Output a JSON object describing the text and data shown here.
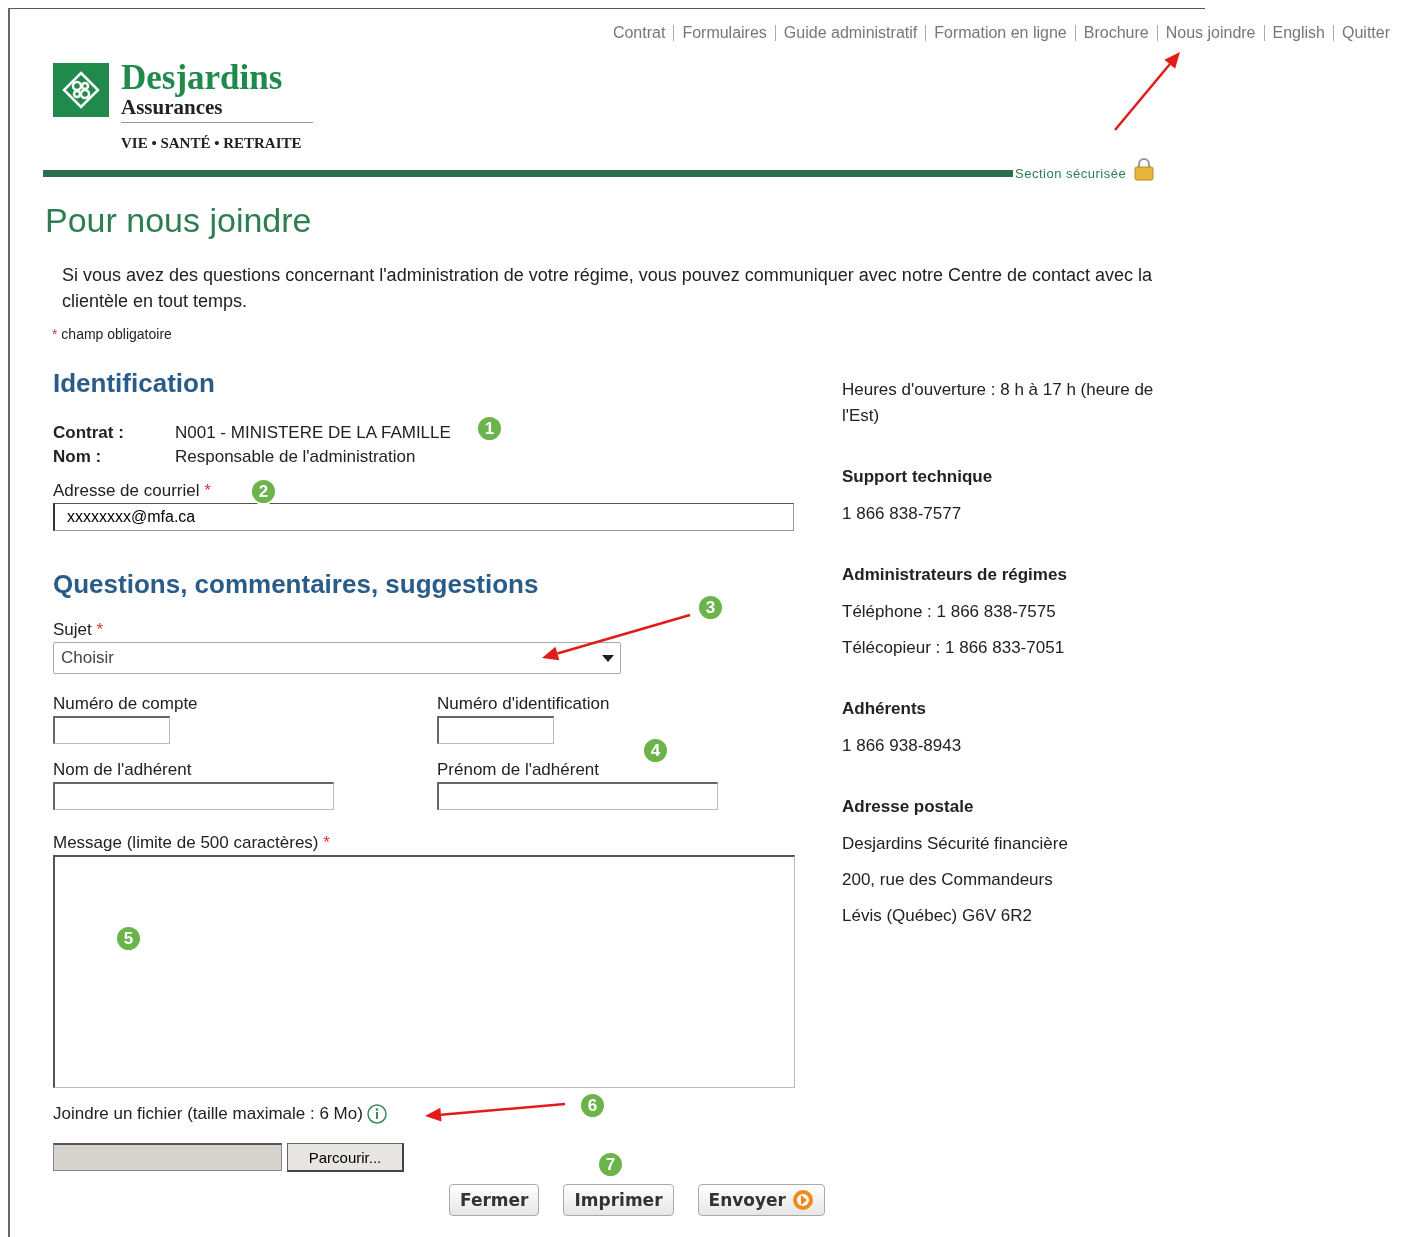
{
  "nav": [
    {
      "label": "Contrat"
    },
    {
      "label": "Formulaires"
    },
    {
      "label": "Guide administratif"
    },
    {
      "label": "Formation en ligne"
    },
    {
      "label": "Brochure"
    },
    {
      "label": "Nous joindre"
    },
    {
      "label": "English"
    },
    {
      "label": "Quitter"
    }
  ],
  "logo": {
    "name": "Desjardins",
    "division": "Assurances",
    "tagline": "VIE • SANTÉ • RETRAITE"
  },
  "secure_label": "Section sécurisée",
  "title": "Pour nous joindre",
  "intro": "Si vous avez des questions concernant l'administration de votre régime, vous pouvez communiquer avec notre Centre de contact avec la clientèle en tout temps.",
  "required_note": {
    "mark": "*",
    "text": "champ obligatoire"
  },
  "identification": {
    "heading": "Identification",
    "info": [
      {
        "label": "Contrat :",
        "value": "N001 - MINISTERE DE LA FAMILLE"
      },
      {
        "label": "Nom :",
        "value": "Responsable de l'administration"
      }
    ],
    "email": {
      "label": "Adresse de courriel",
      "required": true,
      "value": "xxxxxxxx@mfa.ca"
    }
  },
  "questions": {
    "heading": "Questions, commentaires, suggestions",
    "subject": {
      "label": "Sujet",
      "required": true,
      "value": "Choisir"
    },
    "fields": [
      {
        "label": "Numéro de compte",
        "required": false
      },
      {
        "label": "Numéro d'identification",
        "required": false
      },
      {
        "label": "Nom de l'adhérent",
        "required": false
      },
      {
        "label": "Prénom de l'adhérent",
        "required": false
      }
    ],
    "message": {
      "label": "Message (limite de 500 caractères)",
      "required": true
    },
    "attachment": {
      "label": "Joindre un fichier (taille maximale : 6 Mo)",
      "browse": "Parcourir..."
    }
  },
  "buttons": [
    {
      "label": "Fermer",
      "icon": false
    },
    {
      "label": "Imprimer",
      "icon": false
    },
    {
      "label": "Envoyer",
      "icon": true
    }
  ],
  "contact": [
    {
      "lines": [
        "Heures d'ouverture : 8 h à 17 h (heure de l'Est)"
      ]
    },
    {
      "heading": "Support technique",
      "lines": [
        "1 866 838-7577"
      ]
    },
    {
      "heading": "Administrateurs de régimes",
      "lines": [
        "Téléphone : 1 866 838-7575",
        "Télécopieur : 1 866 833-7051"
      ]
    },
    {
      "heading": "Adhérents",
      "lines": [
        "1 866 938-8943"
      ]
    },
    {
      "heading": "Adresse postale",
      "lines": [
        "Desjardins Sécurité financière",
        "200, rue des Commandeurs",
        "Lévis (Québec)  G6V 6R2"
      ]
    }
  ],
  "callouts": [
    "1",
    "2",
    "3",
    "4",
    "5",
    "6",
    "7"
  ]
}
